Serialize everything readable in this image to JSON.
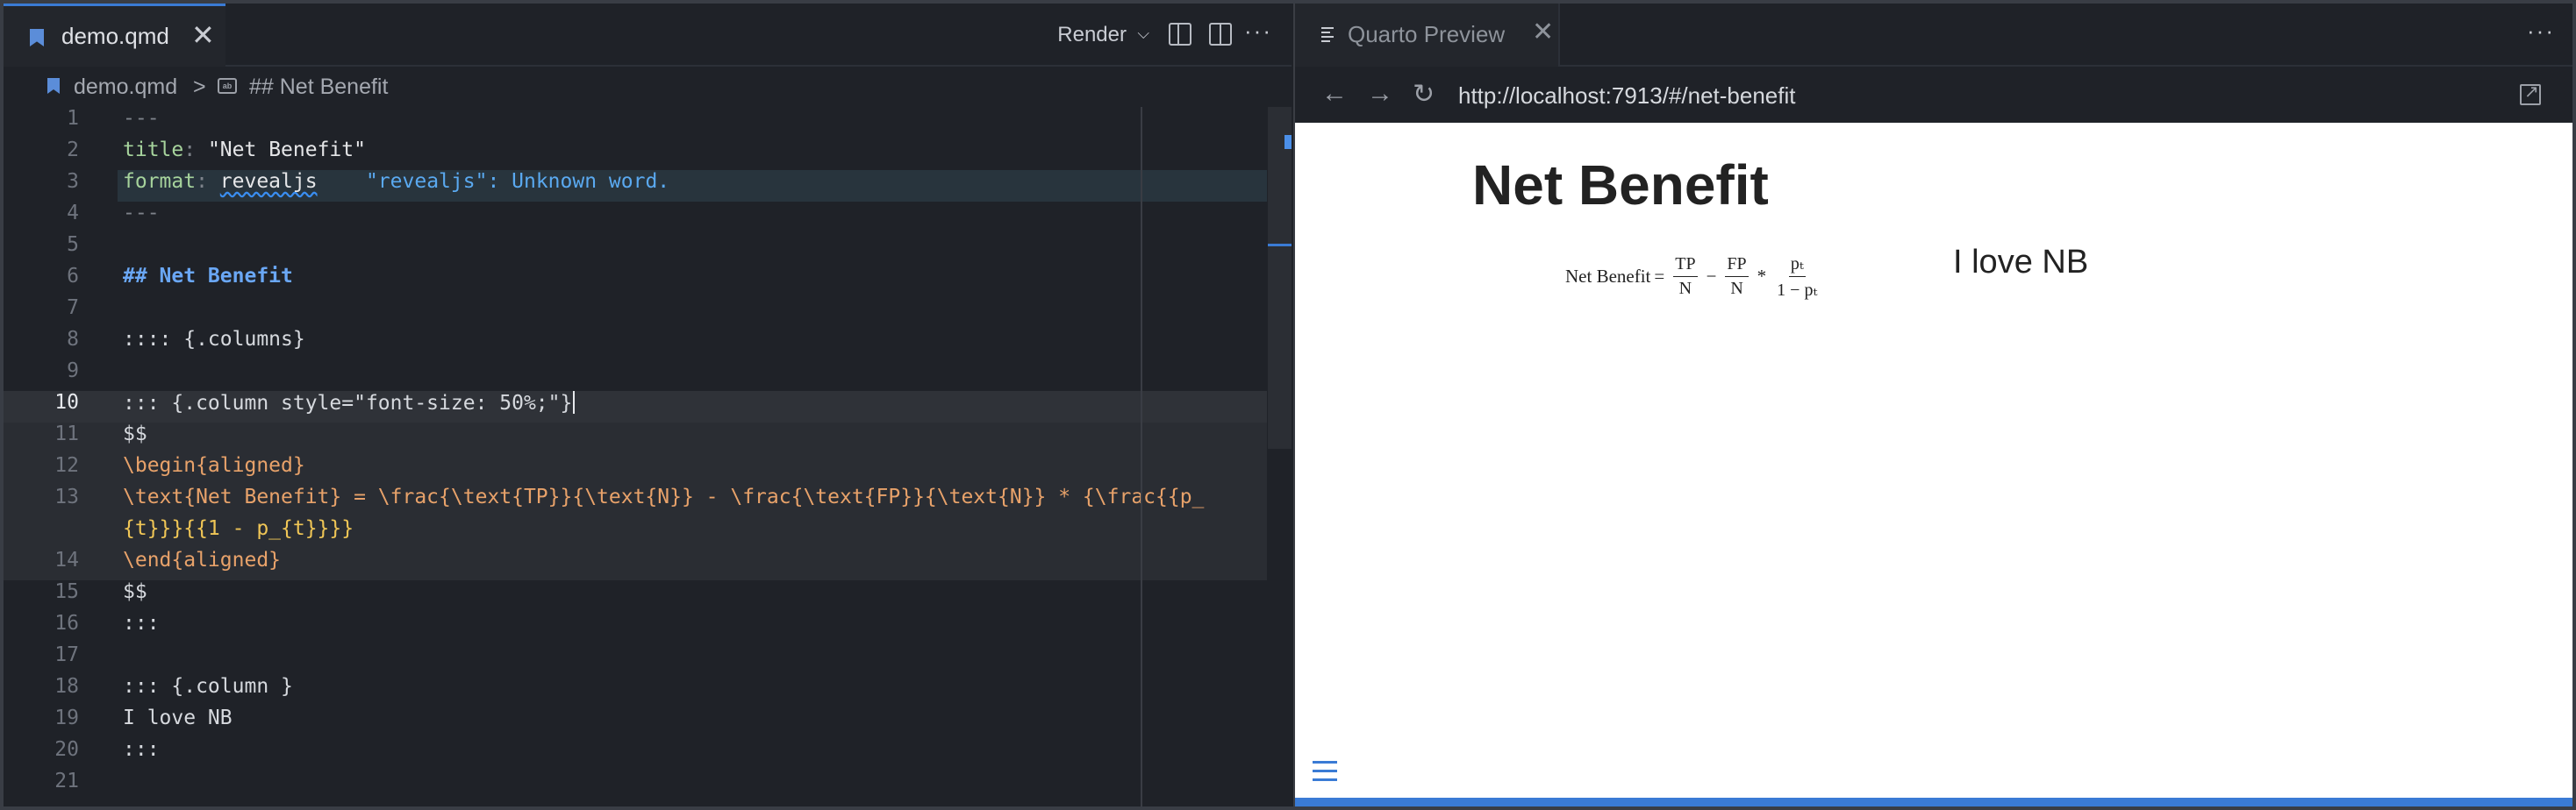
{
  "editor": {
    "tab_label": "demo.qmd",
    "tab_close": "✕",
    "render_label": "Render",
    "render_chevron": "⌵",
    "more": "···",
    "breadcrumb": {
      "file": "demo.qmd",
      "separator": ">",
      "symbol": "## Net Benefit"
    },
    "icons": [
      "quarto-file-icon",
      "close-icon",
      "preview-icon",
      "split-editor-icon",
      "more-icon",
      "chevron-down-icon",
      "symbol-string-icon"
    ],
    "current_line": 10,
    "line_numbers": [
      "1",
      "2",
      "3",
      "4",
      "5",
      "6",
      "7",
      "8",
      "9",
      "10",
      "11",
      "12",
      "13",
      "",
      "14",
      "15",
      "16",
      "17",
      "18",
      "19",
      "20",
      "21"
    ],
    "lines": {
      "l1": "---",
      "l2_key": "title",
      "l2_val": "\"Net Benefit\"",
      "l3_key": "format",
      "l3_val": "revealjs",
      "l3_warning": "\"revealjs\": Unknown word.",
      "l4": "---",
      "l6": "## Net Benefit",
      "l8": ":::: {.columns}",
      "l10": "::: {.column style=\"font-size: 50%;\"}",
      "l11": "$$",
      "l12": "\\begin{aligned}",
      "l13a": "\\text{Net Benefit} = \\frac{\\text{TP}}{\\text{N}} - \\frac{\\text{FP}}{\\text{N}} * {\\frac{{p_",
      "l13b": "{t}}}{{1 - p_{t}}}}",
      "l14": "\\end{aligned}",
      "l15": "$$",
      "l16": ":::",
      "l18": "::: {.column }",
      "l19": "I love NB",
      "l20": ":::"
    }
  },
  "preview": {
    "tab_label": "Quarto Preview",
    "tab_close": "✕",
    "more": "···",
    "url": "http://localhost:7913/#/net-benefit",
    "nav": {
      "back": "←",
      "forward": "→",
      "reload": "↻"
    },
    "slide": {
      "title": "Net Benefit",
      "formula": {
        "lhs": "Net Benefit",
        "eq": "=",
        "f1_num": "TP",
        "f1_den": "N",
        "minus": "−",
        "f2_num": "FP",
        "f2_den": "N",
        "times": "*",
        "f3_num": "pₜ",
        "f3_den": "1 − pₜ"
      },
      "column2_text": "I love NB"
    }
  },
  "colors": {
    "accent": "#3a7bd5",
    "editor_bg": "#1f2228",
    "heading": "#6aa7f5",
    "yaml_key": "#a6d39c",
    "latex_command": "#e8a26a",
    "slide_bg": "#ffffff"
  }
}
